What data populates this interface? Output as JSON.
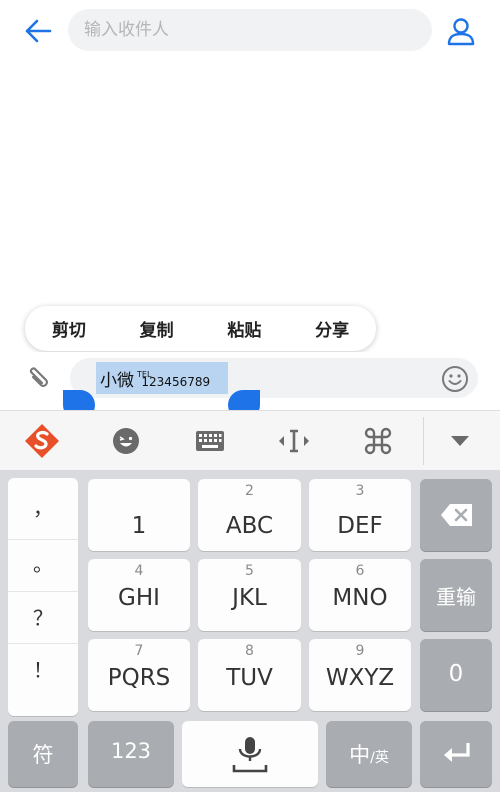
{
  "header": {
    "recipient_placeholder": "输入收件人"
  },
  "context_menu": {
    "items": [
      "剪切",
      "复制",
      "粘贴",
      "分享"
    ]
  },
  "compose": {
    "name": "小微",
    "tel_badge": "TEL",
    "number": "123456789"
  },
  "keyboard": {
    "punctuation": [
      "，",
      "。",
      "？",
      "！"
    ],
    "keys": [
      {
        "num": "",
        "label": "1"
      },
      {
        "num": "2",
        "label": "ABC"
      },
      {
        "num": "3",
        "label": "DEF"
      },
      {
        "num": "4",
        "label": "GHI"
      },
      {
        "num": "5",
        "label": "JKL"
      },
      {
        "num": "6",
        "label": "MNO"
      },
      {
        "num": "7",
        "label": "PQRS"
      },
      {
        "num": "8",
        "label": "TUV"
      },
      {
        "num": "9",
        "label": "WXYZ"
      }
    ],
    "reenter_label": "重输",
    "zero_label": "0",
    "symbol_label": "符",
    "numeric_label": "123",
    "lang_main": "中",
    "lang_sub": "/英"
  },
  "colors": {
    "accent": "#1e73e8",
    "selection": "#b8d4f0",
    "brand_logo": "#e8502a",
    "dark_key": "#a9acb0"
  },
  "icons": {
    "back": "arrow-left-icon",
    "contact": "person-icon",
    "attach": "paperclip-icon",
    "emoji": "smiley-icon",
    "logo": "sogou-logo-icon",
    "toolbar_emoji": "emoji-face-icon",
    "toolbar_keyboard": "keyboard-icon",
    "toolbar_cursor": "cursor-move-icon",
    "toolbar_cmd": "command-icon",
    "collapse": "triangle-down-icon",
    "backspace": "backspace-icon",
    "mic": "mic-icon",
    "enter": "enter-icon"
  }
}
